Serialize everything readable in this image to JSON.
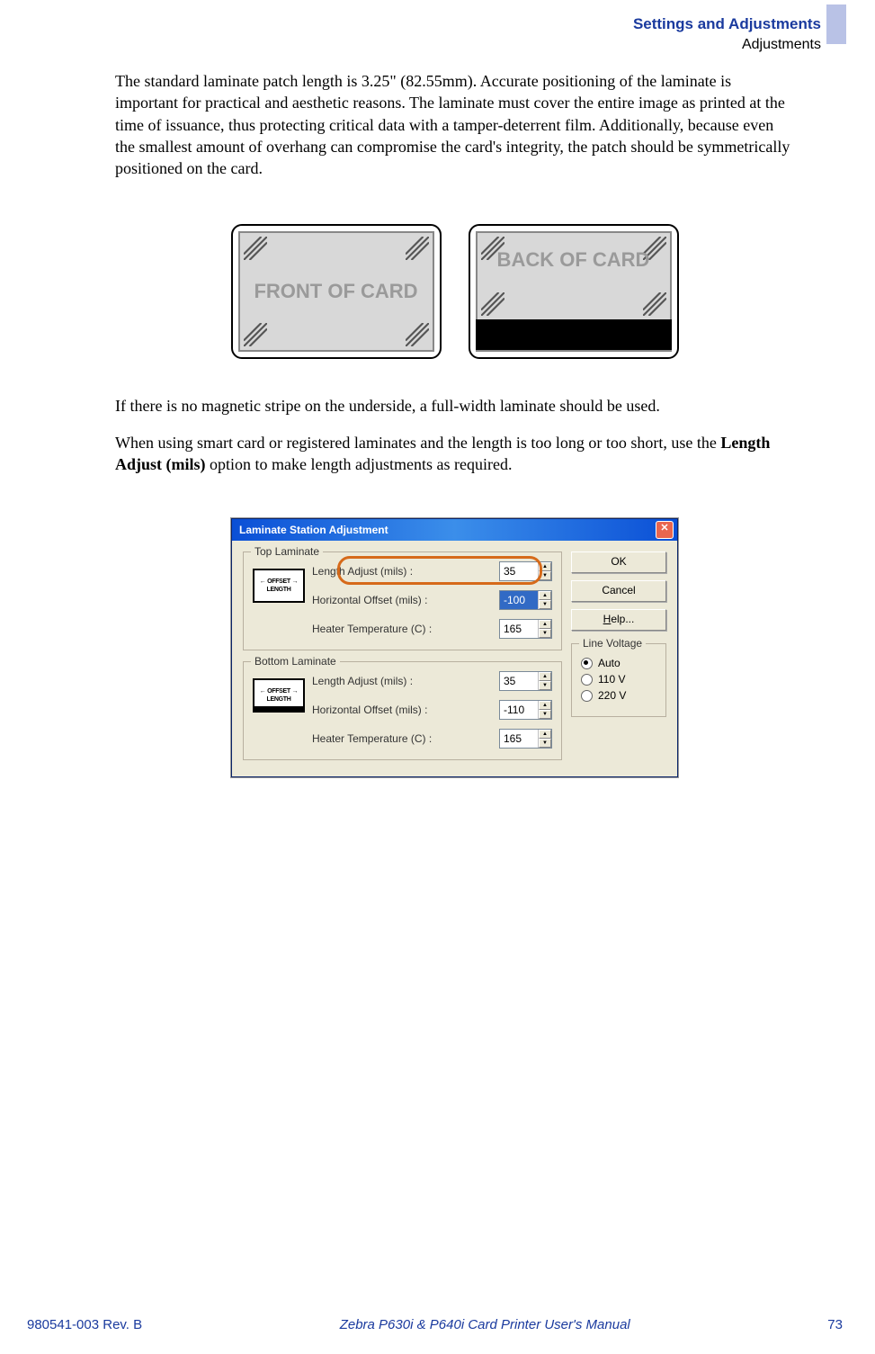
{
  "header": {
    "main": "Settings and Adjustments",
    "sub": "Adjustments"
  },
  "paragraphs": {
    "p1": "The standard laminate patch length is 3.25\" (82.55mm). Accurate positioning of the laminate is important for practical and aesthetic reasons. The laminate must cover the entire image as printed at the time of issuance, thus protecting critical data with a tamper-deterrent film. Additionally, because even the smallest amount of overhang can compromise the card's integrity, the patch should be symmetrically positioned on the card.",
    "p2": "If there is no magnetic stripe on the underside, a full-width laminate should be used.",
    "p3a": "When using smart card or registered laminates and the length is too long or too short, use the ",
    "p3b": "Length Adjust (mils)",
    "p3c": " option to make length adjustments as required."
  },
  "cards": {
    "front_label": "FRONT OF CARD",
    "back_label": "BACK OF CARD"
  },
  "dialog": {
    "title": "Laminate Station Adjustment",
    "top": {
      "legend": "Top Laminate",
      "length_label": "Length Adjust (mils) :",
      "length_value": "35",
      "hoffset_label": "Horizontal Offset (mils) :",
      "hoffset_value": "-100",
      "heater_label": "Heater Temperature (C) :",
      "heater_value": "165"
    },
    "bottom": {
      "legend": "Bottom Laminate",
      "length_label": "Length Adjust (mils) :",
      "length_value": "35",
      "hoffset_label": "Horizontal Offset (mils) :",
      "hoffset_value": "-110",
      "heater_label": "Heater Temperature (C) :",
      "heater_value": "165"
    },
    "buttons": {
      "ok": "OK",
      "cancel": "Cancel",
      "help": "Help..."
    },
    "voltage": {
      "legend": "Line Voltage",
      "auto": "Auto",
      "v110": "110 V",
      "v220": "220 V"
    },
    "diagram": {
      "offset": "← OFFSET →",
      "length": "LENGTH"
    }
  },
  "footer": {
    "left": "980541-003 Rev. B",
    "center": "Zebra P630i & P640i Card Printer User's Manual",
    "right": "73"
  }
}
